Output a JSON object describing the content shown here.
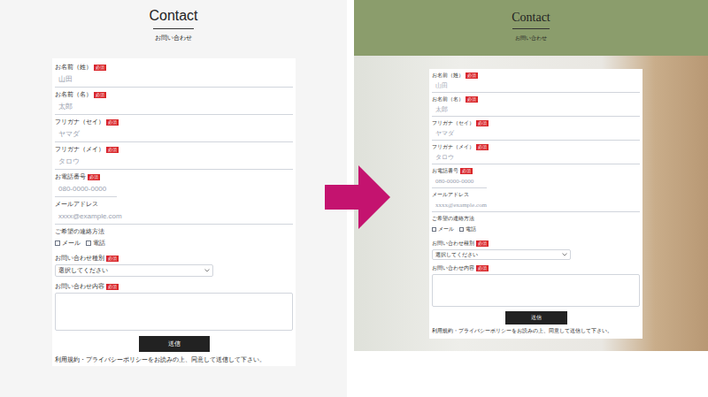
{
  "panels": [
    {
      "kind": "before",
      "title": "Contact",
      "subtitle": "お問い合わせ"
    },
    {
      "kind": "after",
      "title": "Contact",
      "subtitle": "お問い合わせ"
    }
  ],
  "form": {
    "fields": [
      {
        "kind": "text",
        "label": "お名前（姓）",
        "required": true,
        "placeholder": "山田"
      },
      {
        "kind": "text",
        "label": "お名前（名）",
        "required": true,
        "placeholder": "太郎"
      },
      {
        "kind": "text",
        "label": "フリガナ（セイ）",
        "required": true,
        "placeholder": "ヤマダ"
      },
      {
        "kind": "text",
        "label": "フリガナ（メイ）",
        "required": true,
        "placeholder": "タロウ"
      },
      {
        "kind": "phone",
        "label": "お電話番号",
        "required": true,
        "placeholder": "080-0000-0000"
      },
      {
        "kind": "text",
        "label": "メールアドレス",
        "required": false,
        "placeholder": "xxxx@example.com"
      },
      {
        "kind": "checkbox",
        "label": "ご希望の連絡方法",
        "required": false,
        "options": [
          {
            "label": "メール",
            "checked": false
          },
          {
            "label": "電話",
            "checked": false
          }
        ]
      },
      {
        "kind": "select",
        "label": "お問い合わせ種別",
        "required": true,
        "value": "選択してください"
      },
      {
        "kind": "textarea",
        "label": "お問い合わせ内容",
        "required": true
      }
    ],
    "required_badge": "必須",
    "submit": "送信",
    "note": "利用規約・プライバシーポリシーをお読みの上、同意して送信して下さい。"
  }
}
